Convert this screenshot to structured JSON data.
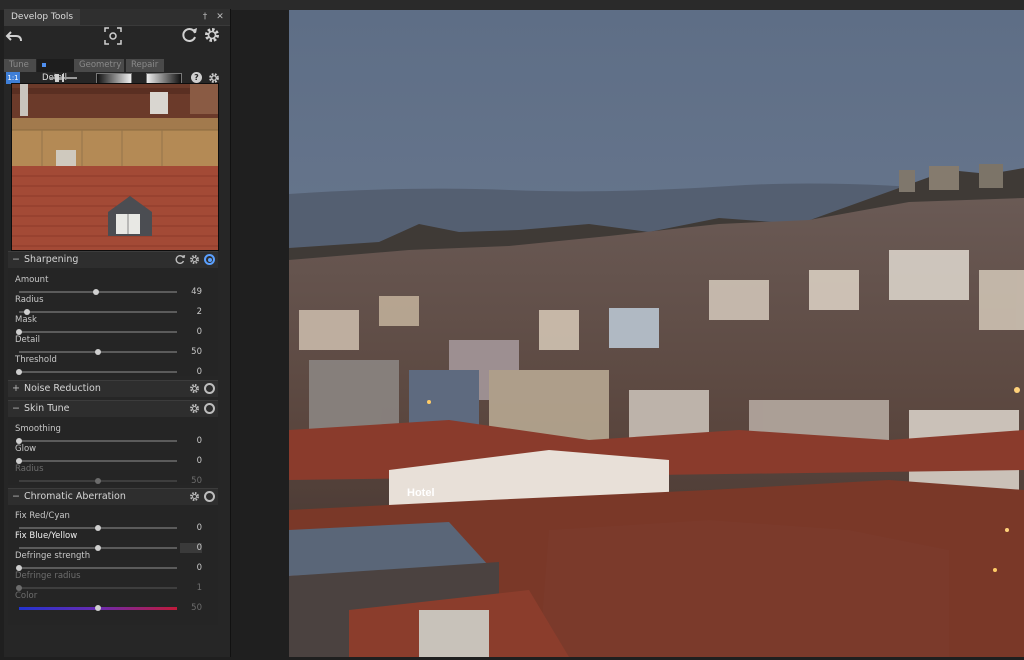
{
  "panel": {
    "title": "Develop Tools",
    "pin_glyph": "†",
    "close_glyph": "✕"
  },
  "toolbar": {
    "undo_icon": "undo-icon",
    "crop_icon": "crop-focus-icon",
    "reset_icon": "refresh-icon",
    "settings_icon": "gear-icon"
  },
  "tabs": [
    {
      "label": "Tune",
      "active": false
    },
    {
      "label": "Detail",
      "active": true
    },
    {
      "label": "Geometry",
      "active": false
    },
    {
      "label": "Repair",
      "active": false
    }
  ],
  "subtoolbar": {
    "zoom_label": "1:1",
    "help_glyph": "?"
  },
  "sections": {
    "sharpening": {
      "title": "Sharpening",
      "expanded_sign": "−",
      "sliders": [
        {
          "label": "Amount",
          "value": "49",
          "pos": 0.49,
          "dim": false
        },
        {
          "label": "Radius",
          "value": "2",
          "pos": 0.05,
          "dim": false
        },
        {
          "label": "Mask",
          "value": "0",
          "pos": 0.0,
          "dim": false
        },
        {
          "label": "Detail",
          "value": "50",
          "pos": 0.5,
          "dim": false
        },
        {
          "label": "Threshold",
          "value": "0",
          "pos": 0.0,
          "dim": false
        }
      ]
    },
    "noise": {
      "title": "Noise Reduction",
      "expanded_sign": "+"
    },
    "skin": {
      "title": "Skin Tune",
      "expanded_sign": "−",
      "sliders": [
        {
          "label": "Smoothing",
          "value": "0",
          "pos": 0.0,
          "dim": false
        },
        {
          "label": "Glow",
          "value": "0",
          "pos": 0.0,
          "dim": false
        },
        {
          "label": "Radius",
          "value": "50",
          "pos": 0.5,
          "dim": true
        }
      ]
    },
    "chromatic": {
      "title": "Chromatic Aberration",
      "expanded_sign": "−",
      "sliders": [
        {
          "label": "Fix Red/Cyan",
          "value": "0",
          "pos": 0.5,
          "dim": false
        },
        {
          "label": "Fix Blue/Yellow",
          "value": "0",
          "pos": 0.5,
          "dim": false,
          "active": true
        },
        {
          "label": "Defringe strength",
          "value": "0",
          "pos": 0.0,
          "dim": false
        },
        {
          "label": "Defringe radius",
          "value": "1",
          "pos": 0.0,
          "dim": true
        },
        {
          "label": "Color",
          "value": "50",
          "pos": 0.5,
          "dim": true,
          "gradient": true
        }
      ]
    }
  },
  "photo": {
    "sign_text": "Hotel"
  }
}
